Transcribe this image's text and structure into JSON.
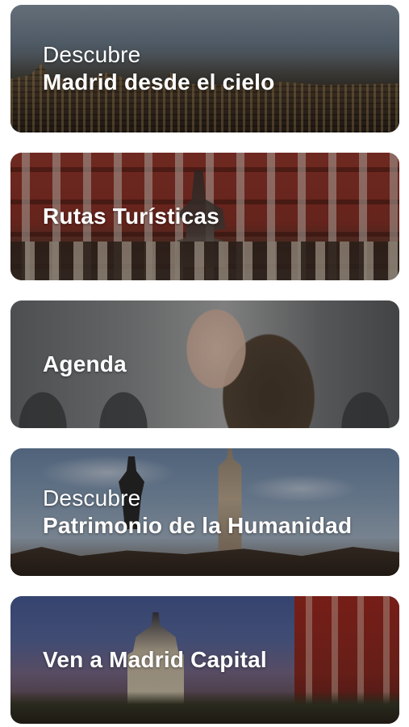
{
  "cards": [
    {
      "kicker": "Descubre",
      "title": "Madrid desde el cielo"
    },
    {
      "kicker": "",
      "title": "Rutas Turísticas"
    },
    {
      "kicker": "",
      "title": "Agenda"
    },
    {
      "kicker": "Descubre",
      "title": "Patrimonio de la Humanidad"
    },
    {
      "kicker": "",
      "title": "Ven a Madrid Capital"
    }
  ],
  "colors": {
    "background": "#ffffff",
    "card_text": "#ffffff"
  }
}
